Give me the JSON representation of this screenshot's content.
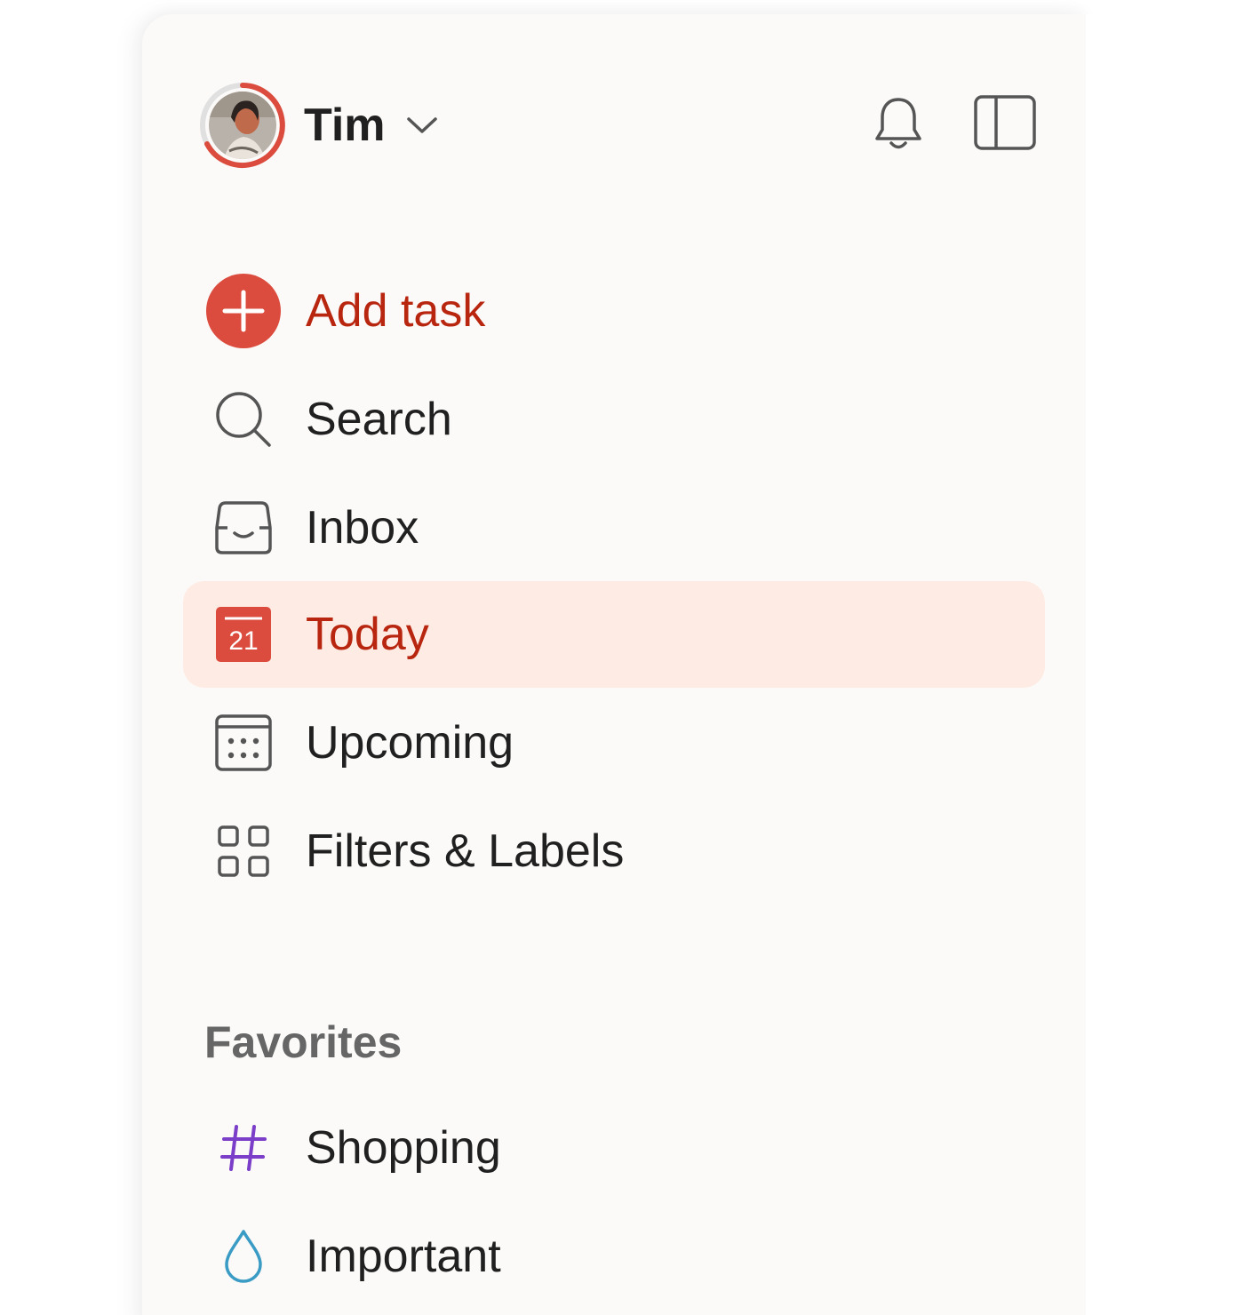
{
  "user": {
    "name": "Tim"
  },
  "nav": {
    "add_task": "Add task",
    "search": "Search",
    "inbox": "Inbox",
    "today": "Today",
    "today_day": "21",
    "upcoming": "Upcoming",
    "filters_labels": "Filters & Labels"
  },
  "favorites": {
    "title": "Favorites",
    "items": [
      {
        "label": "Shopping",
        "icon": "hash-icon",
        "color": "#7a3ec9"
      },
      {
        "label": "Important",
        "icon": "drop-icon",
        "color": "#3a9bc4"
      }
    ]
  },
  "colors": {
    "accent": "#dc4c3e",
    "accent_text": "#b8260f",
    "active_bg": "#feece4",
    "sidebar_bg": "#fcfaf8"
  }
}
